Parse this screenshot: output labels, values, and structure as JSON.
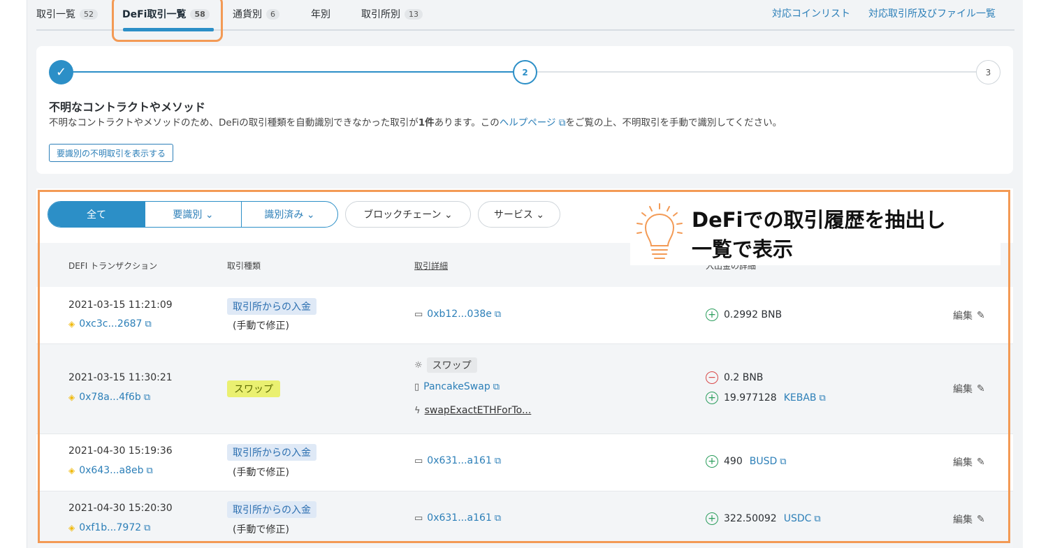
{
  "tabs": [
    {
      "label": "取引一覧",
      "count": "52"
    },
    {
      "label": "DeFi取引一覧",
      "count": "58"
    },
    {
      "label": "通貨別",
      "count": "6"
    },
    {
      "label": "年別",
      "count": ""
    },
    {
      "label": "取引所別",
      "count": "13"
    }
  ],
  "top_links": {
    "coins": "対応コインリスト",
    "exchanges": "対応取引所及びファイル一覧"
  },
  "progress": {
    "step_done": "✓",
    "step_current": "2",
    "step_next": "3",
    "title": "不明なコントラクトやメソッド",
    "desc_before": "不明なコントラクトやメソッドのため、DeFiの取引種類を自動識別できなかった取引が",
    "desc_count": "1件",
    "desc_mid": "あります。この",
    "desc_link": "ヘルプページ",
    "desc_after": "をご覧の上、不明取引を手動で識別してください。",
    "button": "要識別の不明取引を表示する"
  },
  "filters": {
    "all": "全て",
    "needs_id": "要識別 ⌄",
    "identified": "識別済み ⌄",
    "blockchain": "ブロックチェーン ⌄",
    "service": "サービス ⌄"
  },
  "table": {
    "headers": {
      "tx": "DEFI トランザクション",
      "type": "取引種類",
      "detail": "取引詳細",
      "amount": "入出金の詳細"
    },
    "rows": [
      {
        "date": "2021-03-15 11:21:09",
        "hash": "0xc3c...2687",
        "type": "取引所からの入金",
        "type_note": "(手動で修正)",
        "detail": "0xb12...038e",
        "amount_in": "0.2992 BNB",
        "amount_token": "",
        "edit": "編集"
      },
      {
        "date": "2021-03-15 11:30:21",
        "hash": "0x78a...4f6b",
        "type": "スワップ",
        "detail_tag": "スワップ",
        "detail_service": "PancakeSwap",
        "detail_method": "swapExactETHForTo...",
        "amount_out": "0.2 BNB",
        "amount_in": "19.977128",
        "amount_token": "KEBAB",
        "edit": "編集"
      },
      {
        "date": "2021-04-30 15:19:36",
        "hash": "0x643...a8eb",
        "type": "取引所からの入金",
        "type_note": "(手動で修正)",
        "detail": "0x631...a161",
        "amount_in": "490",
        "amount_token": "BUSD",
        "edit": "編集"
      },
      {
        "date": "2021-04-30 15:20:30",
        "hash": "0xf1b...7972",
        "type": "取引所からの入金",
        "type_note": "(手動で修正)",
        "detail": "0x631...a161",
        "amount_in": "322.50092",
        "amount_token": "USDC",
        "edit": "編集"
      }
    ]
  },
  "callout": {
    "line1": "DeFiでの取引履歴を抽出し",
    "line2": "一覧で表示"
  },
  "colors": {
    "accent": "#2c8fc7",
    "highlight": "#f39a55",
    "positive": "#2a9d5c",
    "negative": "#d94848"
  }
}
